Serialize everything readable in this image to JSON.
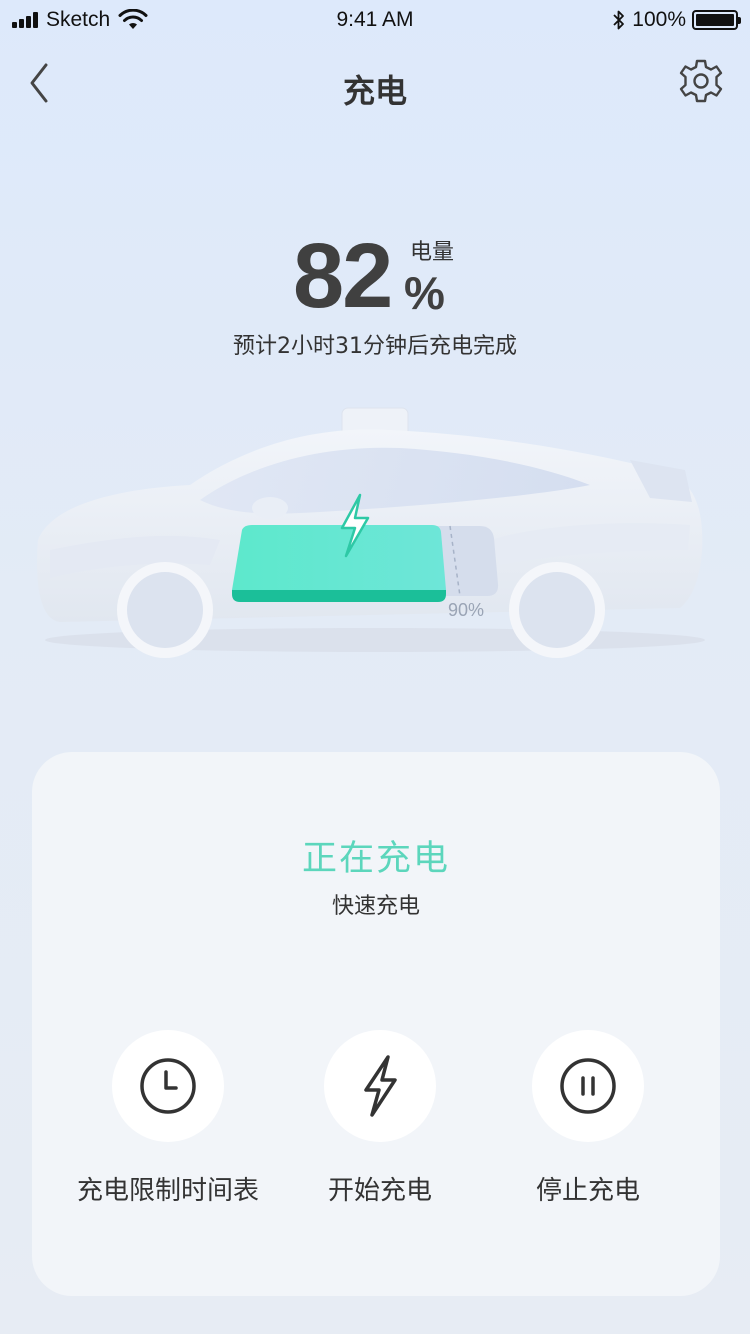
{
  "status_bar": {
    "carrier": "Sketch",
    "time": "9:41 AM",
    "battery_text": "100%",
    "battery_level": 1.0
  },
  "nav": {
    "title": "充电",
    "back_icon": "chevron-left-icon",
    "settings_icon": "gear-icon"
  },
  "battery": {
    "value": "82",
    "unit": "%",
    "label": "电量",
    "eta": "预计2小时31分钟后充电完成",
    "charge_limit_label": "90%",
    "level": 0.82
  },
  "status": {
    "title": "正在充电",
    "mode": "快速充电"
  },
  "actions": [
    {
      "label": "充电限制时间表",
      "icon": "clock-icon"
    },
    {
      "label": "开始充电",
      "icon": "lightning-icon"
    },
    {
      "label": "停止充电",
      "icon": "pause-icon"
    }
  ],
  "colors": {
    "accent": "#5cd6bc",
    "battery_fill": "#5de8cc",
    "text": "#333333"
  }
}
